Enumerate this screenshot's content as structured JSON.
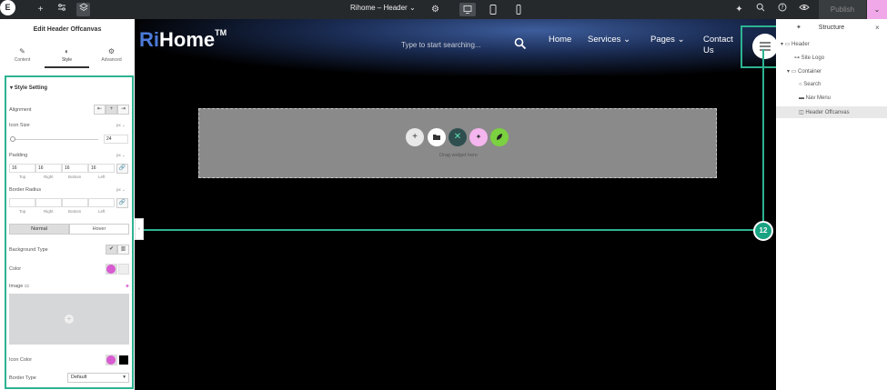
{
  "topbar": {
    "logo": "E",
    "document_title": "Rihome – Header",
    "publish_label": "Publish"
  },
  "left_panel": {
    "title": "Edit Header Offcanvas",
    "tabs": [
      {
        "label": "Content"
      },
      {
        "label": "Style"
      },
      {
        "label": "Advanced"
      }
    ],
    "section_title": "Style Setting",
    "alignment_label": "Alignment",
    "icon_size_label": "Icon Size",
    "icon_size_unit": "px",
    "icon_size_value": "24",
    "padding_label": "Padding",
    "padding_unit": "px",
    "padding_values": [
      "16",
      "16",
      "16",
      "16"
    ],
    "side_labels": [
      "Top",
      "Right",
      "Bottom",
      "Left"
    ],
    "border_radius_label": "Border Radius",
    "border_radius_unit": "px",
    "state_tabs": [
      "Normal",
      "Hover"
    ],
    "background_type_label": "Background Type",
    "color_label": "Color",
    "image_label": "Image",
    "icon_color_label": "Icon Color",
    "border_type_label": "Border Type",
    "border_type_value": "Default"
  },
  "canvas": {
    "logo_prefix": "Ri",
    "logo_rest": "Home",
    "logo_tm": "TM",
    "search_placeholder": "Type to start searching...",
    "nav": [
      "Home",
      "Services",
      "Pages",
      "Contact",
      "Us"
    ],
    "drop_text": "Drag widget here"
  },
  "right_panel": {
    "title": "Structure",
    "tree": [
      "Header",
      "Site Logo",
      "Container",
      "Search",
      "Nav Menu",
      "Header Offcanvas"
    ]
  },
  "callout": {
    "badge": "12"
  },
  "colors": {
    "accent": "#2db391",
    "publish_caret": "#f0a8e8",
    "swatch_pink": "#d85bd1"
  }
}
